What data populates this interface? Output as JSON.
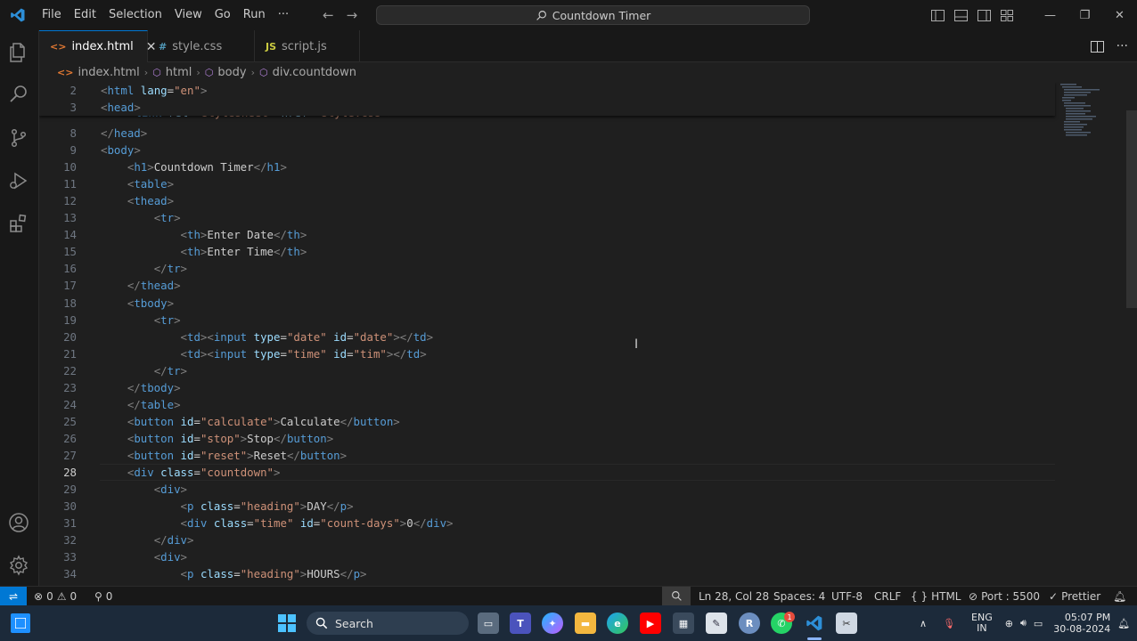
{
  "menu": [
    "File",
    "Edit",
    "Selection",
    "View",
    "Go",
    "Run",
    "···"
  ],
  "command_center": {
    "label": "Countdown Timer"
  },
  "tabs": [
    {
      "label": "index.html",
      "icon": "<>",
      "icon_color": "#e37933",
      "active": true
    },
    {
      "label": "style.css",
      "icon": "#",
      "icon_color": "#519aba",
      "active": false
    },
    {
      "label": "script.js",
      "icon": "JS",
      "icon_color": "#cbcb41",
      "active": false
    }
  ],
  "breadcrumb": [
    "index.html",
    "html",
    "body",
    "div.countdown"
  ],
  "sticky": [
    {
      "n": "2",
      "tokens": [
        [
          "b",
          "<"
        ],
        [
          "t",
          "html"
        ],
        [
          "s",
          " "
        ],
        [
          "a",
          "lang"
        ],
        [
          "e",
          "="
        ],
        [
          "v",
          "\"en\""
        ],
        [
          "b",
          ">"
        ]
      ]
    },
    {
      "n": "3",
      "tokens": [
        [
          "b",
          "<"
        ],
        [
          "t",
          "head"
        ],
        [
          "b",
          ">"
        ]
      ]
    }
  ],
  "peek_line": {
    "tokens": [
      [
        "b",
        "<"
      ],
      [
        "t",
        "link"
      ],
      [
        "s",
        " "
      ],
      [
        "a",
        "rel"
      ],
      [
        "e",
        "="
      ],
      [
        "v",
        "\"stylesheet\""
      ],
      [
        "s",
        " "
      ],
      [
        "a",
        "href"
      ],
      [
        "e",
        "="
      ],
      [
        "v",
        "\"style.css\""
      ],
      [
        "b",
        ">"
      ]
    ]
  },
  "lines": [
    {
      "n": "8",
      "tokens": [
        [
          "b",
          "</"
        ],
        [
          "t",
          "head"
        ],
        [
          "b",
          ">"
        ]
      ]
    },
    {
      "n": "9",
      "tokens": [
        [
          "b",
          "<"
        ],
        [
          "t",
          "body"
        ],
        [
          "b",
          ">"
        ]
      ]
    },
    {
      "n": "10",
      "tokens": [
        [
          "s",
          "    "
        ],
        [
          "b",
          "<"
        ],
        [
          "t",
          "h1"
        ],
        [
          "b",
          ">"
        ],
        [
          "x",
          "Countdown Timer"
        ],
        [
          "b",
          "</"
        ],
        [
          "t",
          "h1"
        ],
        [
          "b",
          ">"
        ]
      ]
    },
    {
      "n": "11",
      "tokens": [
        [
          "s",
          "    "
        ],
        [
          "b",
          "<"
        ],
        [
          "t",
          "table"
        ],
        [
          "b",
          ">"
        ]
      ]
    },
    {
      "n": "12",
      "tokens": [
        [
          "s",
          "    "
        ],
        [
          "b",
          "<"
        ],
        [
          "t",
          "thead"
        ],
        [
          "b",
          ">"
        ]
      ]
    },
    {
      "n": "13",
      "tokens": [
        [
          "s",
          "        "
        ],
        [
          "b",
          "<"
        ],
        [
          "t",
          "tr"
        ],
        [
          "b",
          ">"
        ]
      ]
    },
    {
      "n": "14",
      "tokens": [
        [
          "s",
          "            "
        ],
        [
          "b",
          "<"
        ],
        [
          "t",
          "th"
        ],
        [
          "b",
          ">"
        ],
        [
          "x",
          "Enter Date"
        ],
        [
          "b",
          "</"
        ],
        [
          "t",
          "th"
        ],
        [
          "b",
          ">"
        ]
      ]
    },
    {
      "n": "15",
      "tokens": [
        [
          "s",
          "            "
        ],
        [
          "b",
          "<"
        ],
        [
          "t",
          "th"
        ],
        [
          "b",
          ">"
        ],
        [
          "x",
          "Enter Time"
        ],
        [
          "b",
          "</"
        ],
        [
          "t",
          "th"
        ],
        [
          "b",
          ">"
        ]
      ]
    },
    {
      "n": "16",
      "tokens": [
        [
          "s",
          "        "
        ],
        [
          "b",
          "</"
        ],
        [
          "t",
          "tr"
        ],
        [
          "b",
          ">"
        ]
      ]
    },
    {
      "n": "17",
      "tokens": [
        [
          "s",
          "    "
        ],
        [
          "b",
          "</"
        ],
        [
          "t",
          "thead"
        ],
        [
          "b",
          ">"
        ]
      ]
    },
    {
      "n": "18",
      "tokens": [
        [
          "s",
          "    "
        ],
        [
          "b",
          "<"
        ],
        [
          "t",
          "tbody"
        ],
        [
          "b",
          ">"
        ]
      ]
    },
    {
      "n": "19",
      "tokens": [
        [
          "s",
          "        "
        ],
        [
          "b",
          "<"
        ],
        [
          "t",
          "tr"
        ],
        [
          "b",
          ">"
        ]
      ]
    },
    {
      "n": "20",
      "tokens": [
        [
          "s",
          "            "
        ],
        [
          "b",
          "<"
        ],
        [
          "t",
          "td"
        ],
        [
          "b",
          "><"
        ],
        [
          "t",
          "input"
        ],
        [
          "s",
          " "
        ],
        [
          "a",
          "type"
        ],
        [
          "e",
          "="
        ],
        [
          "v",
          "\"date\""
        ],
        [
          "s",
          " "
        ],
        [
          "a",
          "id"
        ],
        [
          "e",
          "="
        ],
        [
          "v",
          "\"date\""
        ],
        [
          "b",
          "></"
        ],
        [
          "t",
          "td"
        ],
        [
          "b",
          ">"
        ]
      ]
    },
    {
      "n": "21",
      "tokens": [
        [
          "s",
          "            "
        ],
        [
          "b",
          "<"
        ],
        [
          "t",
          "td"
        ],
        [
          "b",
          "><"
        ],
        [
          "t",
          "input"
        ],
        [
          "s",
          " "
        ],
        [
          "a",
          "type"
        ],
        [
          "e",
          "="
        ],
        [
          "v",
          "\"time\""
        ],
        [
          "s",
          " "
        ],
        [
          "a",
          "id"
        ],
        [
          "e",
          "="
        ],
        [
          "v",
          "\"tim\""
        ],
        [
          "b",
          "></"
        ],
        [
          "t",
          "td"
        ],
        [
          "b",
          ">"
        ]
      ]
    },
    {
      "n": "22",
      "tokens": [
        [
          "s",
          "        "
        ],
        [
          "b",
          "</"
        ],
        [
          "t",
          "tr"
        ],
        [
          "b",
          ">"
        ]
      ]
    },
    {
      "n": "23",
      "tokens": [
        [
          "s",
          "    "
        ],
        [
          "b",
          "</"
        ],
        [
          "t",
          "tbody"
        ],
        [
          "b",
          ">"
        ]
      ]
    },
    {
      "n": "24",
      "tokens": [
        [
          "s",
          "    "
        ],
        [
          "b",
          "</"
        ],
        [
          "t",
          "table"
        ],
        [
          "b",
          ">"
        ]
      ]
    },
    {
      "n": "25",
      "tokens": [
        [
          "s",
          "    "
        ],
        [
          "b",
          "<"
        ],
        [
          "t",
          "button"
        ],
        [
          "s",
          " "
        ],
        [
          "a",
          "id"
        ],
        [
          "e",
          "="
        ],
        [
          "v",
          "\"calculate\""
        ],
        [
          "b",
          ">"
        ],
        [
          "x",
          "Calculate"
        ],
        [
          "b",
          "</"
        ],
        [
          "t",
          "button"
        ],
        [
          "b",
          ">"
        ]
      ]
    },
    {
      "n": "26",
      "tokens": [
        [
          "s",
          "    "
        ],
        [
          "b",
          "<"
        ],
        [
          "t",
          "button"
        ],
        [
          "s",
          " "
        ],
        [
          "a",
          "id"
        ],
        [
          "e",
          "="
        ],
        [
          "v",
          "\"stop\""
        ],
        [
          "b",
          ">"
        ],
        [
          "x",
          "Stop"
        ],
        [
          "b",
          "</"
        ],
        [
          "t",
          "button"
        ],
        [
          "b",
          ">"
        ]
      ]
    },
    {
      "n": "27",
      "tokens": [
        [
          "s",
          "    "
        ],
        [
          "b",
          "<"
        ],
        [
          "t",
          "button"
        ],
        [
          "s",
          " "
        ],
        [
          "a",
          "id"
        ],
        [
          "e",
          "="
        ],
        [
          "v",
          "\"reset\""
        ],
        [
          "b",
          ">"
        ],
        [
          "x",
          "Reset"
        ],
        [
          "b",
          "</"
        ],
        [
          "t",
          "button"
        ],
        [
          "b",
          ">"
        ]
      ]
    },
    {
      "n": "28",
      "current": true,
      "tokens": [
        [
          "s",
          "    "
        ],
        [
          "b",
          "<"
        ],
        [
          "t",
          "div"
        ],
        [
          "s",
          " "
        ],
        [
          "a",
          "class"
        ],
        [
          "e",
          "="
        ],
        [
          "v",
          "\"countdown\""
        ],
        [
          "b",
          ">"
        ]
      ]
    },
    {
      "n": "29",
      "tokens": [
        [
          "s",
          "        "
        ],
        [
          "b",
          "<"
        ],
        [
          "t",
          "div"
        ],
        [
          "b",
          ">"
        ]
      ]
    },
    {
      "n": "30",
      "tokens": [
        [
          "s",
          "            "
        ],
        [
          "b",
          "<"
        ],
        [
          "t",
          "p"
        ],
        [
          "s",
          " "
        ],
        [
          "a",
          "class"
        ],
        [
          "e",
          "="
        ],
        [
          "v",
          "\"heading\""
        ],
        [
          "b",
          ">"
        ],
        [
          "x",
          "DAY"
        ],
        [
          "b",
          "</"
        ],
        [
          "t",
          "p"
        ],
        [
          "b",
          ">"
        ]
      ]
    },
    {
      "n": "31",
      "tokens": [
        [
          "s",
          "            "
        ],
        [
          "b",
          "<"
        ],
        [
          "t",
          "div"
        ],
        [
          "s",
          " "
        ],
        [
          "a",
          "class"
        ],
        [
          "e",
          "="
        ],
        [
          "v",
          "\"time\""
        ],
        [
          "s",
          " "
        ],
        [
          "a",
          "id"
        ],
        [
          "e",
          "="
        ],
        [
          "v",
          "\"count-days\""
        ],
        [
          "b",
          ">"
        ],
        [
          "x",
          "0"
        ],
        [
          "b",
          "</"
        ],
        [
          "t",
          "div"
        ],
        [
          "b",
          ">"
        ]
      ]
    },
    {
      "n": "32",
      "tokens": [
        [
          "s",
          "        "
        ],
        [
          "b",
          "</"
        ],
        [
          "t",
          "div"
        ],
        [
          "b",
          ">"
        ]
      ]
    },
    {
      "n": "33",
      "tokens": [
        [
          "s",
          "        "
        ],
        [
          "b",
          "<"
        ],
        [
          "t",
          "div"
        ],
        [
          "b",
          ">"
        ]
      ]
    },
    {
      "n": "34",
      "tokens": [
        [
          "s",
          "            "
        ],
        [
          "b",
          "<"
        ],
        [
          "t",
          "p"
        ],
        [
          "s",
          " "
        ],
        [
          "a",
          "class"
        ],
        [
          "e",
          "="
        ],
        [
          "v",
          "\"heading\""
        ],
        [
          "b",
          ">"
        ],
        [
          "x",
          "HOURS"
        ],
        [
          "b",
          "</"
        ],
        [
          "t",
          "p"
        ],
        [
          "b",
          ">"
        ]
      ]
    }
  ],
  "status": {
    "errors": "0",
    "warnings": "0",
    "ports": "0",
    "position": "Ln 28, Col 28",
    "spaces": "Spaces: 4",
    "encoding": "UTF-8",
    "eol": "CRLF",
    "language": "HTML",
    "port": "Port : 5500",
    "prettier": "Prettier"
  },
  "taskbar": {
    "search_label": "Search",
    "lang_top": "ENG",
    "lang_bottom": "IN",
    "time": "05:07 PM",
    "date": "30-08-2024",
    "whatsapp_badge": "1",
    "r_label": "R"
  },
  "colors": {
    "accent": "#0078d4",
    "tag": "#569cd6",
    "attr": "#9cdcfe",
    "string": "#ce9178"
  }
}
